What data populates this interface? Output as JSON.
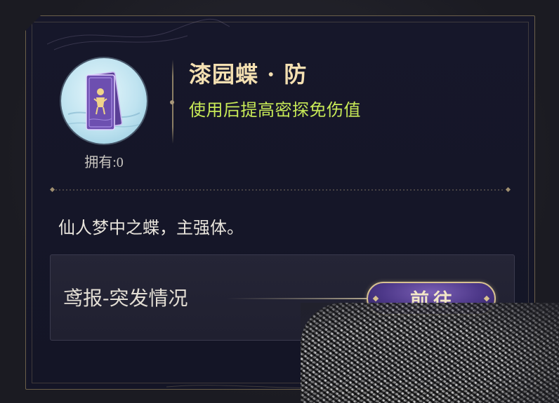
{
  "item": {
    "name": "漆园蝶 · 防",
    "effect": "使用后提高密探免伤值",
    "owned_label": "拥有:0",
    "owned_count": 0,
    "description": "仙人梦中之蝶，主强体。"
  },
  "source": {
    "label": "鸢报-突发情况",
    "go_button_label": "前往"
  },
  "colors": {
    "title": "#f3dfb1",
    "effect": "#c8ea57",
    "frame": "#6b5f4a",
    "button_bg": "#4d3889",
    "button_border": "#d7c190"
  },
  "icons": {
    "item_icon": "card-with-figure-icon",
    "go_button_ornament": "diamond-icon"
  }
}
